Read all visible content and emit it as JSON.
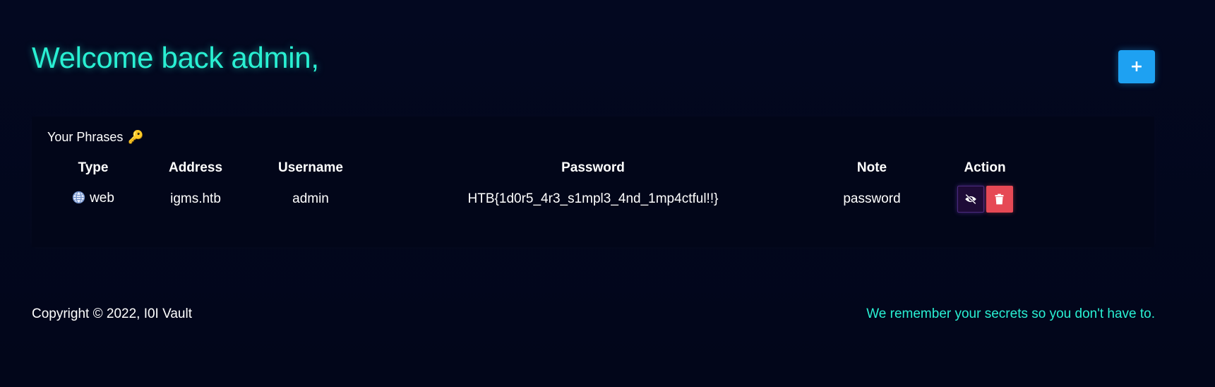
{
  "header": {
    "welcome": "Welcome back admin,",
    "add_button_label": "+"
  },
  "phrases": {
    "title": "Your Phrases",
    "title_icon": "🔑",
    "columns": [
      "Type",
      "Address",
      "Username",
      "Password",
      "Note",
      "Action"
    ],
    "rows": [
      {
        "type_icon": "globe-icon",
        "type": "web",
        "address": "igms.htb",
        "username": "admin",
        "password": "HTB{1d0r5_4r3_s1mpl3_4nd_1mp4ctful!!}",
        "note": "password",
        "actions": [
          "eye-slash-icon",
          "trash-icon"
        ]
      }
    ]
  },
  "footer": {
    "copyright": "Copyright © 2022, I0I Vault",
    "tagline": "We remember your secrets so you don't have to."
  },
  "colors": {
    "background": "#02071c",
    "accent": "#29f0d3",
    "add_button": "#1ea1f2",
    "show_button": "#1e0b37",
    "delete_button": "#e64955"
  }
}
